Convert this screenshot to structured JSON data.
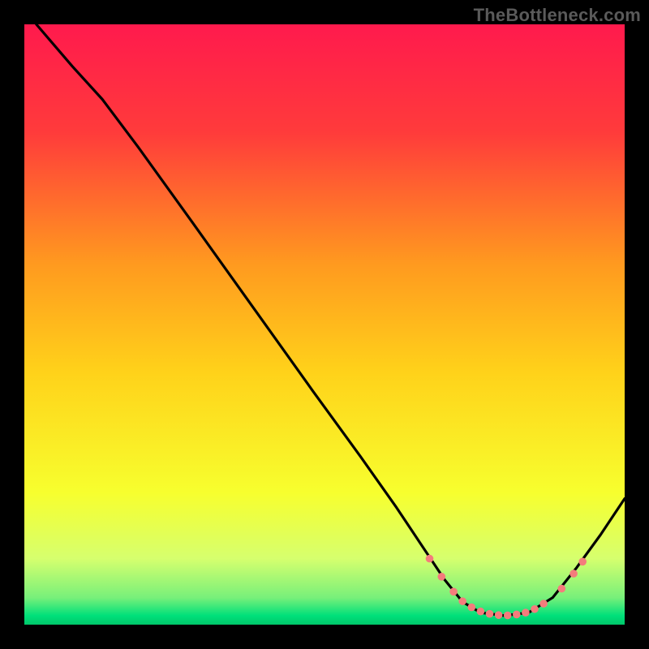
{
  "attribution": "TheBottleneck.com",
  "chart_data": {
    "type": "line",
    "title": "",
    "xlabel": "",
    "ylabel": "",
    "xlim": [
      0,
      100
    ],
    "ylim": [
      0,
      100
    ],
    "grid": false,
    "legend": false,
    "background": {
      "type": "vertical-gradient",
      "stops": [
        {
          "pos": 0.0,
          "color": "#ff1a4d"
        },
        {
          "pos": 0.18,
          "color": "#ff3b3b"
        },
        {
          "pos": 0.4,
          "color": "#ff9a1f"
        },
        {
          "pos": 0.58,
          "color": "#ffd21a"
        },
        {
          "pos": 0.78,
          "color": "#f7ff2e"
        },
        {
          "pos": 0.89,
          "color": "#d6ff6e"
        },
        {
          "pos": 0.955,
          "color": "#78f07a"
        },
        {
          "pos": 0.985,
          "color": "#00e07a"
        },
        {
          "pos": 1.0,
          "color": "#00c76a"
        }
      ]
    },
    "series": [
      {
        "name": "curve",
        "color": "#000000",
        "points": [
          {
            "x": 2.0,
            "y": 100.0
          },
          {
            "x": 8.0,
            "y": 93.0
          },
          {
            "x": 13.0,
            "y": 87.5
          },
          {
            "x": 19.0,
            "y": 79.5
          },
          {
            "x": 28.0,
            "y": 67.0
          },
          {
            "x": 38.0,
            "y": 53.0
          },
          {
            "x": 48.0,
            "y": 39.0
          },
          {
            "x": 56.0,
            "y": 28.0
          },
          {
            "x": 62.0,
            "y": 19.5
          },
          {
            "x": 66.0,
            "y": 13.5
          },
          {
            "x": 70.0,
            "y": 7.5
          },
          {
            "x": 73.0,
            "y": 3.8
          },
          {
            "x": 76.0,
            "y": 2.0
          },
          {
            "x": 80.0,
            "y": 1.5
          },
          {
            "x": 84.0,
            "y": 2.0
          },
          {
            "x": 88.0,
            "y": 4.5
          },
          {
            "x": 92.0,
            "y": 9.5
          },
          {
            "x": 96.0,
            "y": 15.0
          },
          {
            "x": 100.0,
            "y": 21.0
          }
        ]
      }
    ],
    "markers": {
      "color": "#f47c7c",
      "radius_pct": 0.65,
      "points": [
        {
          "x": 67.5,
          "y": 11.0
        },
        {
          "x": 69.5,
          "y": 8.0
        },
        {
          "x": 71.5,
          "y": 5.5
        },
        {
          "x": 73.0,
          "y": 3.9
        },
        {
          "x": 74.5,
          "y": 2.9
        },
        {
          "x": 76.0,
          "y": 2.2
        },
        {
          "x": 77.5,
          "y": 1.8
        },
        {
          "x": 79.0,
          "y": 1.6
        },
        {
          "x": 80.5,
          "y": 1.55
        },
        {
          "x": 82.0,
          "y": 1.7
        },
        {
          "x": 83.5,
          "y": 2.0
        },
        {
          "x": 85.0,
          "y": 2.6
        },
        {
          "x": 86.5,
          "y": 3.5
        },
        {
          "x": 89.5,
          "y": 6.0
        },
        {
          "x": 91.5,
          "y": 8.5
        },
        {
          "x": 93.0,
          "y": 10.5
        }
      ]
    }
  }
}
